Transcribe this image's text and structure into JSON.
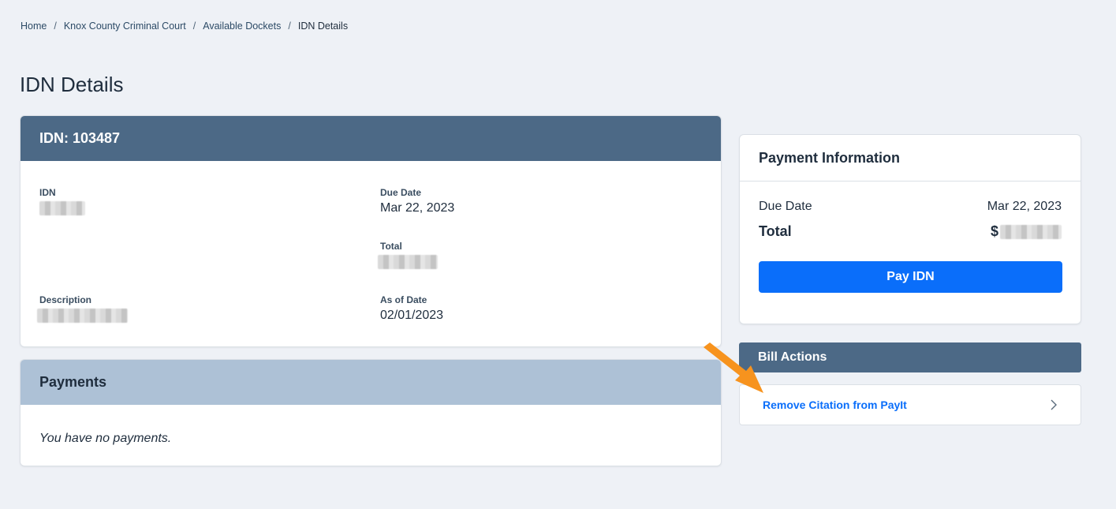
{
  "breadcrumb": {
    "items": [
      "Home",
      "Knox County Criminal Court",
      "Available Dockets"
    ],
    "current": "IDN Details",
    "separator": "/"
  },
  "page_title": "IDN Details",
  "idn_card": {
    "header": "IDN: 103487",
    "fields": {
      "idn_label": "IDN",
      "due_date_label": "Due Date",
      "due_date_value": "Mar 22, 2023",
      "total_label": "Total",
      "description_label": "Description",
      "as_of_date_label": "As of Date",
      "as_of_date_value": "02/01/2023"
    }
  },
  "payments": {
    "header": "Payments",
    "empty_text": "You have no payments."
  },
  "payment_info": {
    "title": "Payment Information",
    "due_date_label": "Due Date",
    "due_date_value": "Mar 22, 2023",
    "total_label": "Total",
    "total_prefix": "$",
    "pay_button": "Pay IDN"
  },
  "bill_actions": {
    "header": "Bill Actions",
    "items": [
      {
        "label": "Remove Citation from PayIt"
      }
    ]
  },
  "colors": {
    "header_dark": "#4c6986",
    "header_light": "#adc1d6",
    "primary": "#0a6efa",
    "annotation_arrow": "#f7931e",
    "background": "#eef1f6"
  }
}
